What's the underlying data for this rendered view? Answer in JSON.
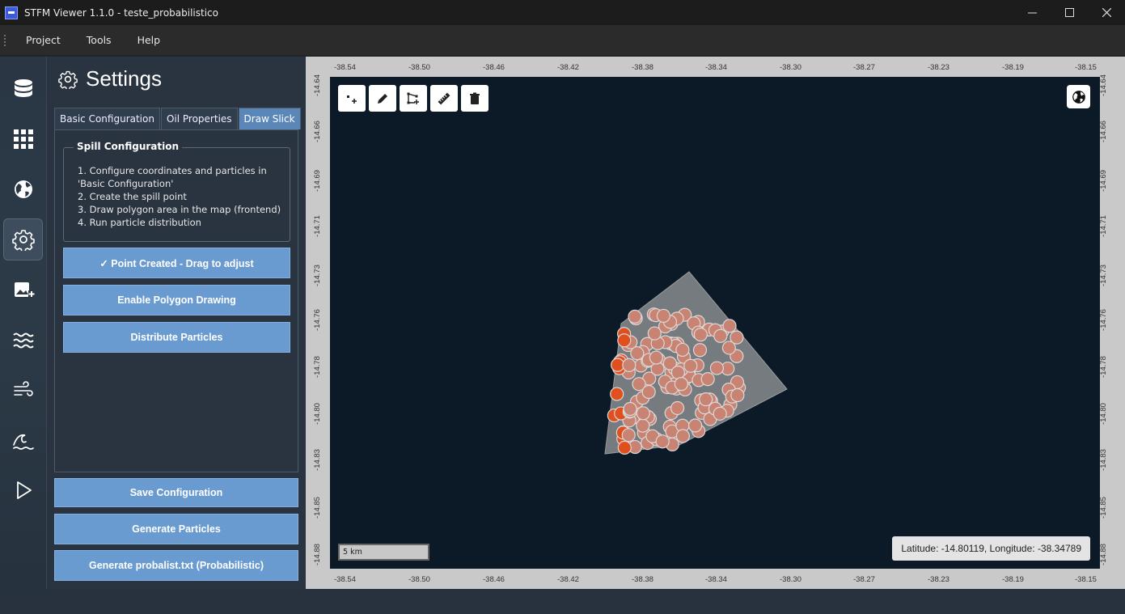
{
  "window": {
    "title": "STFM Viewer 1.1.0 - teste_probabilistico",
    "icon": "app-icon",
    "controls": [
      "minimize-icon",
      "maximize-icon",
      "close-icon"
    ]
  },
  "menu": [
    "Project",
    "Tools",
    "Help"
  ],
  "rail": [
    {
      "name": "database-icon",
      "active": false
    },
    {
      "name": "grid-icon",
      "active": false
    },
    {
      "name": "globe-icon",
      "active": false
    },
    {
      "name": "gear-icon",
      "active": true
    },
    {
      "name": "add-image-icon",
      "active": false
    },
    {
      "name": "waves-icon",
      "active": false
    },
    {
      "name": "wind-icon",
      "active": false
    },
    {
      "name": "ocean-wave-icon",
      "active": false
    },
    {
      "name": "play-icon",
      "active": false
    }
  ],
  "settings": {
    "title": "Settings",
    "tabs": [
      {
        "label": "Basic Configuration",
        "active": false
      },
      {
        "label": "Oil Properties",
        "active": false
      },
      {
        "label": "Draw Slick",
        "active": true
      }
    ],
    "spill": {
      "title": "Spill Configuration",
      "steps": [
        "1. Configure coordinates and particles in 'Basic Configuration'",
        "2. Create the spill point",
        "3. Draw polygon area in the map (frontend)",
        "4. Run particle distribution"
      ]
    },
    "draw_buttons": {
      "point": "✓ Point Created - Drag to adjust",
      "polygon": "Enable Polygon Drawing",
      "distribute": "Distribute Particles"
    },
    "bottom_buttons": {
      "save": "Save Configuration",
      "generate": "Generate Particles",
      "probalist": "Generate probalist.txt (Probabilistic)"
    }
  },
  "map": {
    "x_ticks": [
      "-38.54",
      "-38.50",
      "-38.46",
      "-38.42",
      "-38.38",
      "-38.34",
      "-38.30",
      "-38.27",
      "-38.23",
      "-38.19",
      "-38.15"
    ],
    "y_ticks": [
      "-14.64",
      "-14.66",
      "-14.69",
      "-14.71",
      "-14.73",
      "-14.76",
      "-14.78",
      "-14.80",
      "-14.83",
      "-14.85",
      "-14.88"
    ],
    "tools": [
      "add-point-icon",
      "pencil-icon",
      "polygon-draw-icon",
      "ruler-icon",
      "trash-icon"
    ],
    "basemap_icon": "globe-icon",
    "scale_label": "5 km",
    "coordinates": "Latitude: -14.80119, Longitude: -38.34789",
    "colors": {
      "ocean": "#0c1a28",
      "polygon": "#8a8d8f",
      "particle": "#c98373",
      "edge_particle": "#e0501e"
    }
  }
}
